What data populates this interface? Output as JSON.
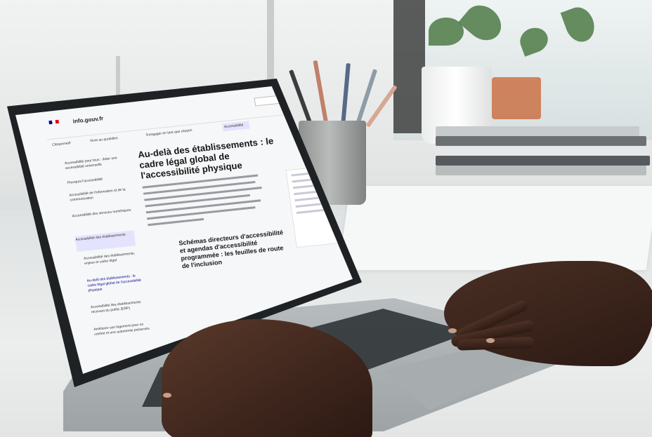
{
  "screen": {
    "brand": "info.gouv.fr",
    "nav": [
      "Citoyenneté",
      "Vivre au quotidien",
      "S'engager en tant que citoyen",
      "Accessibilité"
    ],
    "sidebar": [
      "Accessibilité pour tous : doter une accessibilité universelle",
      "Pourquoi l'accessibilité",
      "Accessibilité de l'information et de la communication",
      "Accessibilité des services numériques",
      "Accessibilité des établissements",
      "Accessibilité des établissements, enjeux et cadre légal",
      "Au-delà des établissements : le cadre légal global de l'accessibilité physique",
      "Accessibilité des établissements recevant du public (ERP)",
      "Améliorer son logement pour un confort et une autonomie préservés"
    ],
    "title": "Au-delà des établissements : le cadre légal global de l'accessibilité physique",
    "subheading": "Schémas directeurs d'accessibilité et agendas d'accessibilité programmée : les feuilles de route de l'inclusion"
  }
}
